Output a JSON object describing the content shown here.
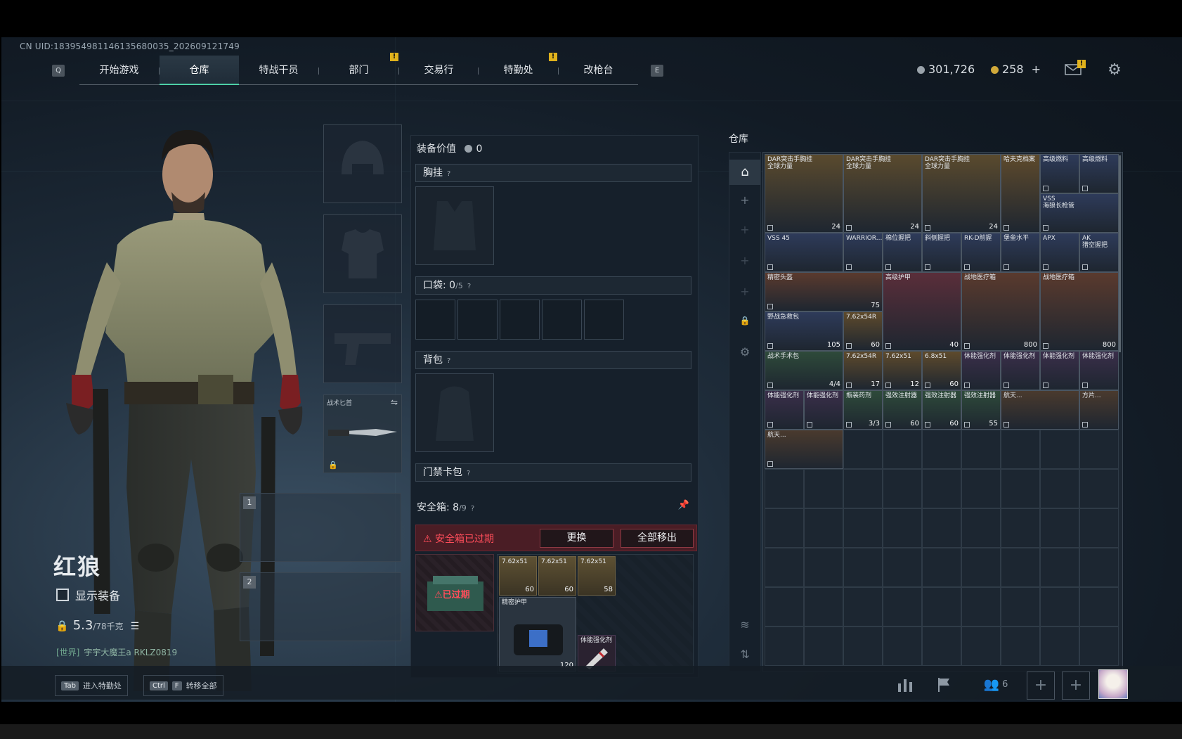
{
  "uid": "CN UID:183954981146135680035_202609121749",
  "nav": {
    "left_key": "Q",
    "right_key": "E",
    "tabs": [
      "开始游戏",
      "仓库",
      "特战干员",
      "部门",
      "交易行",
      "特勤处",
      "改枪台"
    ],
    "active_tab": "仓库",
    "alert_tabs": [
      "部门",
      "特勤处"
    ],
    "alert_mark": "!"
  },
  "currency": {
    "silver": "301,726",
    "gold": "258",
    "gold_add": "+"
  },
  "colors": {
    "accent": "#4dd0a7",
    "alert": "#e0b21c",
    "expired": "#ff4d5a"
  },
  "character": {
    "name": "红狼",
    "show_equipment_label": "显示装备",
    "weight_value": "5.3",
    "weight_capacity": "/78千克",
    "world_tag": "[世界]",
    "world_user": "宇宇大魔王a RKLZ0819",
    "knife_label": "战术匕首",
    "weapon_slots": [
      "1",
      "2"
    ]
  },
  "equipment_panel": {
    "value_label": "装备价值",
    "value": "0",
    "chest_label": "胸挂",
    "pocket_label": "口袋:",
    "pocket_count": "0",
    "pocket_capacity": "/5",
    "backpack_label": "背包",
    "keycard_label": "门禁卡包",
    "help_mark": "?",
    "safebox_label": "安全箱:",
    "safebox_count": "8",
    "safebox_capacity": "/9",
    "expired_warning": "安全箱已过期",
    "replace_button": "更换",
    "move_all_button": "全部移出",
    "expired_overlay": "已过期",
    "case_items": [
      {
        "name": "7.62x51",
        "qty": "60"
      },
      {
        "name": "7.62x51",
        "qty": "60"
      },
      {
        "name": "7.62x51",
        "qty": "58"
      },
      {
        "name": "精密护甲",
        "qty": "120"
      },
      {
        "name": "体能强化剂",
        "qty": ""
      }
    ]
  },
  "warehouse": {
    "title": "仓库",
    "items": [
      {
        "name": "DAR突击手胸挂\n全球力量",
        "qty": "24",
        "color": "#5a4a2e"
      },
      {
        "name": "DAR突击手胸挂\n全球力量",
        "qty": "24",
        "color": "#5a4a2e"
      },
      {
        "name": "DAR突击手胸挂\n全球力量",
        "qty": "24",
        "color": "#5a4a2e"
      },
      {
        "name": "哈夫克档案",
        "qty": "",
        "color": "#5e4a2c"
      },
      {
        "name": "高级燃料",
        "qty": "",
        "color": "#2e3b5a"
      },
      {
        "name": "高级燃料",
        "qty": "",
        "color": "#2e3b5a"
      },
      {
        "name": "VSS\n海狼长枪管",
        "qty": "",
        "color": "#2e3b5a"
      },
      {
        "name": "VSS 45",
        "qty": "",
        "color": "#2e3b5a"
      },
      {
        "name": "WARRIOR...",
        "qty": "",
        "color": "#2e3b5a"
      },
      {
        "name": "棉位握把",
        "qty": "",
        "color": "#2e3b5a"
      },
      {
        "name": "斜侧握把",
        "qty": "",
        "color": "#2e3b5a"
      },
      {
        "name": "RK-D前握",
        "qty": "",
        "color": "#2e3b5a"
      },
      {
        "name": "堡垒水平",
        "qty": "",
        "color": "#2e3b5a"
      },
      {
        "name": "APX",
        "qty": "",
        "color": "#2e3b5a"
      },
      {
        "name": "AK\n猎空握把",
        "qty": "",
        "color": "#2e3b5a"
      },
      {
        "name": "精密头盔",
        "qty": "75",
        "color": "#5a3a2e"
      },
      {
        "name": "高级护甲",
        "qty": "40",
        "color": "#5a2e3a"
      },
      {
        "name": "战地医疗箱",
        "qty": "800",
        "color": "#5a3a2e"
      },
      {
        "name": "战地医疗箱",
        "qty": "800",
        "color": "#5a3a2e"
      },
      {
        "name": "野战急救包",
        "qty": "105",
        "color": "#2e3b5a"
      },
      {
        "name": "7.62x54R",
        "qty": "60",
        "color": "#5e4a2c"
      },
      {
        "name": "战术手术包",
        "qty": "4/4",
        "color": "#2e4a3a"
      },
      {
        "name": "7.62x54R",
        "qty": "17",
        "color": "#5e4a2c"
      },
      {
        "name": "7.62x51",
        "qty": "12",
        "color": "#5e4a2c"
      },
      {
        "name": "6.8x51",
        "qty": "60",
        "color": "#5e4a2c"
      },
      {
        "name": "体能强化剂",
        "qty": "",
        "color": "#3a2e4a"
      },
      {
        "name": "体能强化剂",
        "qty": "",
        "color": "#3a2e4a"
      },
      {
        "name": "体能强化剂",
        "qty": "",
        "color": "#3a2e4a"
      },
      {
        "name": "体能强化剂",
        "qty": "",
        "color": "#3a2e4a"
      },
      {
        "name": "体能强化剂",
        "qty": "",
        "color": "#3a2e4a"
      },
      {
        "name": "体能强化剂",
        "qty": "",
        "color": "#3a2e4a"
      },
      {
        "name": "瓶装药剂",
        "qty": "3/3",
        "color": "#2e4a3a"
      },
      {
        "name": "强效注射器",
        "qty": "60",
        "color": "#2e4a3a"
      },
      {
        "name": "强效注射器",
        "qty": "60",
        "color": "#2e4a3a"
      },
      {
        "name": "强效注射器",
        "qty": "55",
        "color": "#2e4a3a"
      },
      {
        "name": "航天...",
        "qty": "",
        "color": "#4a3a2e"
      },
      {
        "name": "方片...",
        "qty": "",
        "color": "#4a3a2e"
      },
      {
        "name": "航天...",
        "qty": "",
        "color": "#4a3a2e"
      }
    ]
  },
  "bottom": {
    "tab_key": "Tab",
    "tab_hint": "进入特勤处",
    "ctrl_key": "Ctrl",
    "f_key": "F",
    "transfer_hint": "转移全部",
    "squad_count": "6"
  }
}
